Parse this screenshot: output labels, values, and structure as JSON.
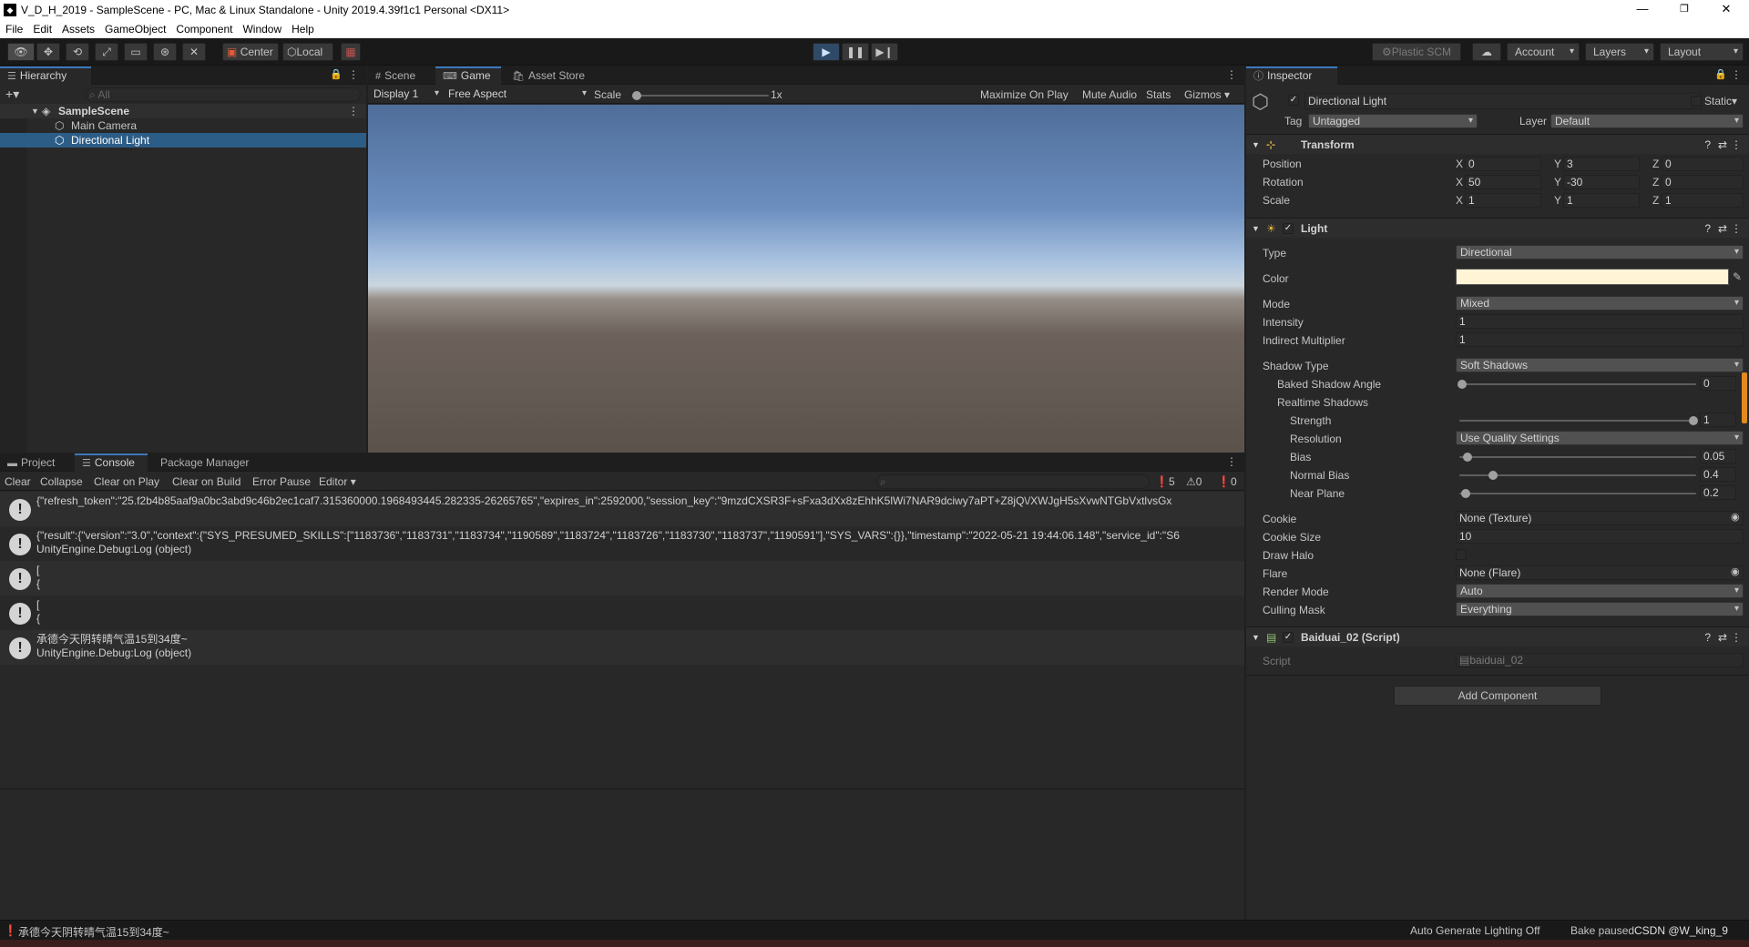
{
  "window": {
    "title": "V_D_H_2019 - SampleScene - PC, Mac & Linux Standalone - Unity 2019.4.39f1c1 Personal <DX11>",
    "app_icon": "unity-logo-icon",
    "controls": [
      "—",
      "❐",
      "✕"
    ]
  },
  "menu": [
    "File",
    "Edit",
    "Assets",
    "GameObject",
    "Component",
    "Window",
    "Help"
  ],
  "toolbar": {
    "tools": [
      "hand-tool-icon",
      "move-tool-icon",
      "rotate-tool-icon",
      "scale-tool-icon",
      "rect-tool-icon",
      "transform-tool-icon",
      "custom-tool-icon"
    ],
    "pivot": "Center",
    "space": "Local",
    "plastic": "Plastic SCM",
    "account": "Account",
    "layers": "Layers",
    "layout": "Layout"
  },
  "hierarchy": {
    "tab": "Hierarchy",
    "add": "+",
    "search_placeholder": "All",
    "scene": "SampleScene",
    "items": [
      "Main Camera",
      "Directional Light"
    ],
    "selected": "Directional Light"
  },
  "game": {
    "tabs": [
      "Scene",
      "Game",
      "Asset Store"
    ],
    "active_tab": "Game",
    "display": "Display 1",
    "aspect": "Free Aspect",
    "scale_label": "Scale",
    "scale_value": "1x",
    "options": [
      "Maximize On Play",
      "Mute Audio",
      "Stats",
      "Gizmos"
    ]
  },
  "console": {
    "tabs": [
      "Project",
      "Console",
      "Package Manager"
    ],
    "active_tab": "Console",
    "buttons": [
      "Clear",
      "Collapse",
      "Clear on Play",
      "Clear on Build",
      "Error Pause",
      "Editor"
    ],
    "counts": {
      "log": "5",
      "warn": "0",
      "error": "0"
    },
    "logs": [
      {
        "line1": "{\"refresh_token\":\"25.f2b4b85aaf9a0bc3abd9c46b2ec1caf7.315360000.1968493445.282335-26265765\",\"expires_in\":2592000,\"session_key\":\"9mzdCXSR3F+sFxa3dXx8zEhhK5lWi7NAR9dciwy7aPT+Z8jQ\\/XWJgH5sXvwNTGbVxtlvsGx",
        "line2": ""
      },
      {
        "line1": "{\"result\":{\"version\":\"3.0\",\"context\":{\"SYS_PRESUMED_SKILLS\":[\"1183736\",\"1183731\",\"1183734\",\"1190589\",\"1183724\",\"1183726\",\"1183730\",\"1183737\",\"1190591\"],\"SYS_VARS\":{}},\"timestamp\":\"2022-05-21 19:44:06.148\",\"service_id\":\"S6",
        "line2": "UnityEngine.Debug:Log (object)"
      },
      {
        "line1": "[",
        "line2": "  {"
      },
      {
        "line1": "[",
        "line2": "  {"
      },
      {
        "line1": "承德今天阴转晴气温15到34度~",
        "line2": "UnityEngine.Debug:Log (object)"
      }
    ]
  },
  "inspector": {
    "tab": "Inspector",
    "object_name": "Directional Light",
    "static_label": "Static",
    "tag_label": "Tag",
    "tag": "Untagged",
    "layer_label": "Layer",
    "layer": "Default",
    "transform": {
      "title": "Transform",
      "position_label": "Position",
      "rotation_label": "Rotation",
      "scale_label": "Scale",
      "position": {
        "x": "0",
        "y": "3",
        "z": "0"
      },
      "rotation": {
        "x": "50",
        "y": "-30",
        "z": "0"
      },
      "scale": {
        "x": "1",
        "y": "1",
        "z": "1"
      },
      "axes": [
        "X",
        "Y",
        "Z"
      ]
    },
    "light": {
      "title": "Light",
      "type_label": "Type",
      "type": "Directional",
      "color_label": "Color",
      "color": "#fff4d6",
      "mode_label": "Mode",
      "mode": "Mixed",
      "intensity_label": "Intensity",
      "intensity": "1",
      "indirect_label": "Indirect Multiplier",
      "indirect": "1",
      "shadow_type_label": "Shadow Type",
      "shadow_type": "Soft Shadows",
      "baked_angle_label": "Baked Shadow Angle",
      "baked_angle": "0",
      "realtime_label": "Realtime Shadows",
      "strength_label": "Strength",
      "strength": "1",
      "resolution_label": "Resolution",
      "resolution": "Use Quality Settings",
      "bias_label": "Bias",
      "bias": "0.05",
      "normal_bias_label": "Normal Bias",
      "normal_bias": "0.4",
      "near_plane_label": "Near Plane",
      "near_plane": "0.2",
      "cookie_label": "Cookie",
      "cookie": "None (Texture)",
      "cookie_size_label": "Cookie Size",
      "cookie_size": "10",
      "draw_halo_label": "Draw Halo",
      "flare_label": "Flare",
      "flare": "None (Flare)",
      "render_mode_label": "Render Mode",
      "render_mode": "Auto",
      "culling_label": "Culling Mask",
      "culling": "Everything"
    },
    "script": {
      "title": "Baiduai_02 (Script)",
      "script_label": "Script",
      "script_value": "baiduai_02"
    },
    "add_component": "Add Component"
  },
  "statusbar": {
    "message": "承德今天阴转晴气温15到34度~",
    "auto_lighting": "Auto Generate Lighting Off",
    "bake": "Bake paused",
    "watermark": "CSDN @W_king_9"
  },
  "colors": {
    "accent": "#3a79bb",
    "selection": "#2c5d87",
    "play": "#2f4a66"
  }
}
